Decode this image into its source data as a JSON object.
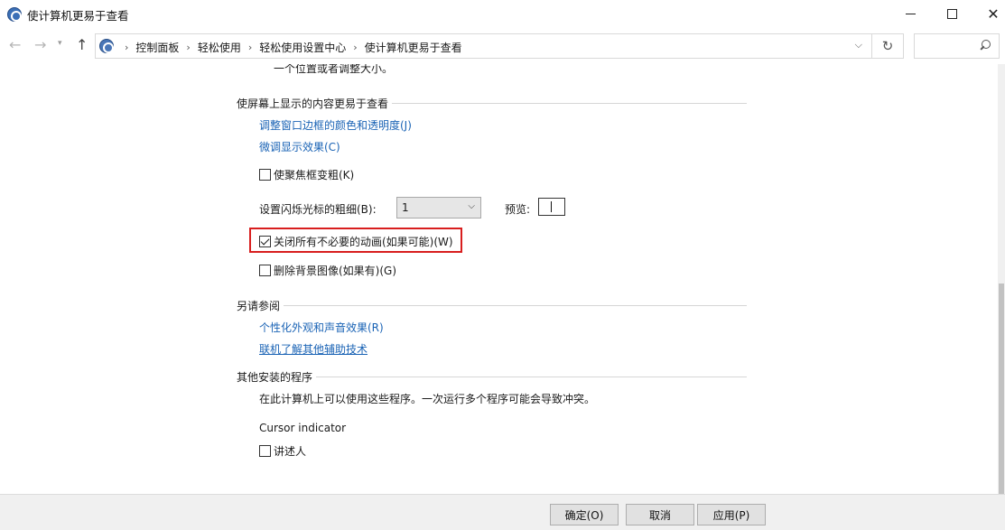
{
  "window": {
    "title": "使计算机更易于查看"
  },
  "nav": {
    "back_glyph": "←",
    "forward_glyph": "→",
    "up_glyph": "↑",
    "breadcrumbs": [
      "控制面板",
      "轻松使用",
      "轻松使用设置中心",
      "使计算机更易于查看"
    ],
    "search_placeholder": ""
  },
  "content": {
    "clipped_text": "一个位置或者调整大小。",
    "section_screen": {
      "title": "使屏幕上显示的内容更易于查看",
      "link_border": "调整窗口边框的颜色和透明度(J)",
      "link_fine_tune": "微调显示效果(C)",
      "checkbox_focus": {
        "label": "使聚焦框变粗(K)",
        "checked": false
      },
      "cursor_thickness_label": "设置闪烁光标的粗细(B):",
      "cursor_thickness_value": "1",
      "preview_label": "预览:",
      "checkbox_animations": {
        "label": "关闭所有不必要的动画(如果可能)(W)",
        "checked": true
      },
      "checkbox_background": {
        "label": "删除背景图像(如果有)(G)",
        "checked": false
      }
    },
    "section_see_also": {
      "title": "另请参阅",
      "link_personalize": "个性化外观和声音效果(R)",
      "link_learn_more": "联机了解其他辅助技术"
    },
    "section_other": {
      "title": "其他安装的程序",
      "description": "在此计算机上可以使用这些程序。一次运行多个程序可能会导致冲突。",
      "program_name": "Cursor indicator",
      "checkbox_narrator": {
        "label": "讲述人",
        "checked": false
      }
    }
  },
  "footer": {
    "ok_label": "确定(O)",
    "cancel_label": "取消",
    "apply_label": "应用(P)"
  },
  "colors": {
    "link": "#1a63b5",
    "highlight_border": "#d81e1e"
  }
}
